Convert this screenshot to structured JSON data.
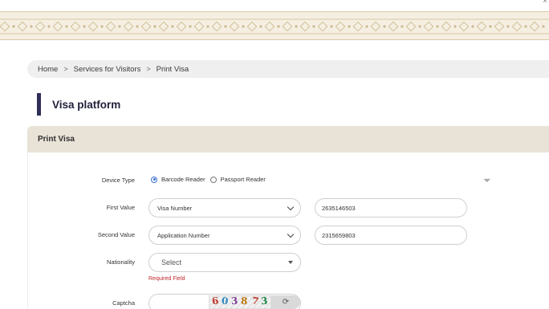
{
  "breadcrumb": {
    "items": [
      "Home",
      "Services for Visitors",
      "Print Visa"
    ],
    "separator": ">"
  },
  "page": {
    "title": "Visa platform",
    "title_accent_color": "#2f2f5a"
  },
  "panel": {
    "header": "Print Visa",
    "header_bg": "#e9e2d7"
  },
  "form": {
    "device_type": {
      "label": "Device Type",
      "options": [
        "Barcode Reader",
        "Passport Reader"
      ],
      "selected": "Barcode Reader"
    },
    "first_value": {
      "label": "First Value",
      "select_value": "Visa Number",
      "input_value": "2635146503"
    },
    "second_value": {
      "label": "Second Value",
      "select_value": "Application Number",
      "input_value": "2315659803"
    },
    "nationality": {
      "label": "Nationality",
      "placeholder": "Select",
      "error": "Required Field",
      "error_color": "#c0282d"
    },
    "captcha": {
      "label": "Captcha",
      "chars": [
        "6",
        "0",
        "3",
        "8",
        "7",
        "3"
      ],
      "char_colors": [
        "#c0392b",
        "#2e86c1",
        "#7d3c98",
        "#b9770e",
        "#c0392b",
        "#1e8449"
      ],
      "refresh_icon": "refresh-icon"
    }
  }
}
